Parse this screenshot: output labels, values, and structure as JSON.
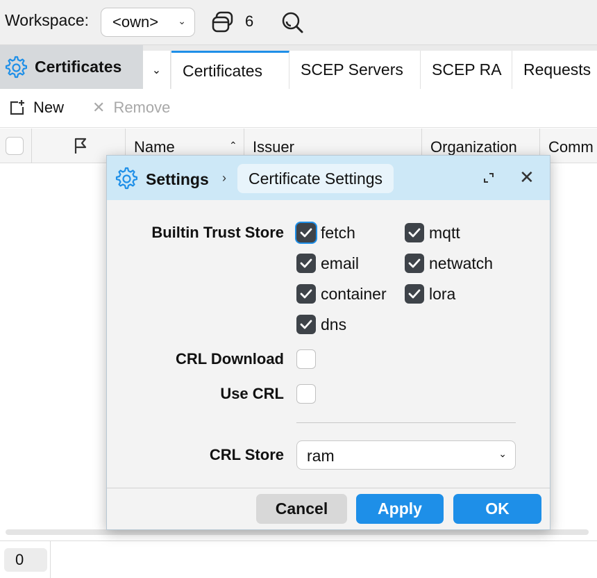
{
  "topbar": {
    "workspace_label": "Workspace:",
    "workspace_value": "<own>",
    "window_count": "6"
  },
  "tabs_row": {
    "menu_title": "Certificates",
    "tabs": [
      {
        "label": "Certificates"
      },
      {
        "label": "SCEP Servers"
      },
      {
        "label": "SCEP RA"
      },
      {
        "label": "Requests"
      }
    ]
  },
  "toolbar": {
    "new_label": "New",
    "remove_label": "Remove"
  },
  "table": {
    "columns": [
      "Name",
      "Issuer",
      "Organization",
      "Comm"
    ]
  },
  "statusbar": {
    "count": "0"
  },
  "dialog": {
    "title": "Settings",
    "breadcrumb": "Certificate Settings",
    "builtin_trust_store_label": "Builtin Trust Store",
    "trust_stores": [
      {
        "label": "fetch",
        "checked": true
      },
      {
        "label": "mqtt",
        "checked": true
      },
      {
        "label": "email",
        "checked": true
      },
      {
        "label": "netwatch",
        "checked": true
      },
      {
        "label": "container",
        "checked": true
      },
      {
        "label": "lora",
        "checked": true
      },
      {
        "label": "dns",
        "checked": true
      }
    ],
    "crl_download_label": "CRL Download",
    "crl_download_checked": false,
    "use_crl_label": "Use CRL",
    "use_crl_checked": false,
    "crl_store_label": "CRL Store",
    "crl_store_value": "ram",
    "cancel_label": "Cancel",
    "apply_label": "Apply",
    "ok_label": "OK"
  },
  "colors": {
    "accent": "#1e8fe8",
    "dialog_header": "#cde8f7",
    "checkbox_checked": "#3e4349"
  }
}
